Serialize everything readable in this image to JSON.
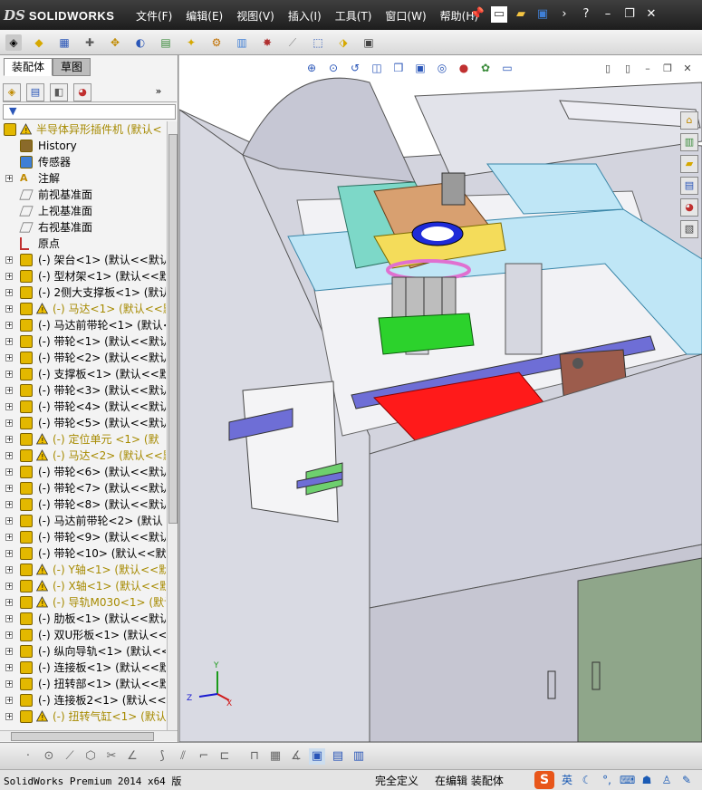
{
  "app": {
    "logo_ds": "DS",
    "logo_text": "SOLIDWORKS"
  },
  "menu": [
    "文件(F)",
    "编辑(E)",
    "视图(V)",
    "插入(I)",
    "工具(T)",
    "窗口(W)",
    "帮助(H)"
  ],
  "panel": {
    "tabs": [
      "装配体",
      "草图"
    ],
    "tree": [
      {
        "label": "半导体异形插件机  (默认<",
        "warn": true,
        "yellow": true,
        "icon": "assembly",
        "exp": "",
        "indent": 0
      },
      {
        "label": "History",
        "icon": "history",
        "exp": "",
        "indent": 1
      },
      {
        "label": "传感器",
        "icon": "sensor",
        "exp": "",
        "indent": 1
      },
      {
        "label": "注解",
        "icon": "annotation",
        "exp": "+",
        "indent": 1
      },
      {
        "label": "前视基准面",
        "icon": "plane",
        "exp": "",
        "indent": 1
      },
      {
        "label": "上视基准面",
        "icon": "plane",
        "exp": "",
        "indent": 1
      },
      {
        "label": "右视基准面",
        "icon": "plane",
        "exp": "",
        "indent": 1
      },
      {
        "label": "原点",
        "icon": "origin",
        "exp": "",
        "indent": 1
      },
      {
        "label": "(-) 架台<1> (默认<<默认",
        "icon": "part",
        "exp": "+",
        "indent": 1
      },
      {
        "label": "(-) 型材架<1> (默认<<默",
        "icon": "part",
        "exp": "+",
        "indent": 1
      },
      {
        "label": "(-) 2侧大支撑板<1> (默认",
        "icon": "part",
        "exp": "+",
        "indent": 1
      },
      {
        "label": "(-) 马达<1> (默认<<默",
        "warn": true,
        "yellow": true,
        "icon": "part",
        "exp": "+",
        "indent": 1
      },
      {
        "label": "(-) 马达前带轮<1> (默认<",
        "icon": "part",
        "exp": "+",
        "indent": 1
      },
      {
        "label": "(-) 带轮<1> (默认<<默认",
        "icon": "part",
        "exp": "+",
        "indent": 1
      },
      {
        "label": "(-) 带轮<2> (默认<<默认",
        "icon": "part",
        "exp": "+",
        "indent": 1
      },
      {
        "label": "(-) 支撑板<1> (默认<<默",
        "icon": "part",
        "exp": "+",
        "indent": 1
      },
      {
        "label": "(-) 带轮<3> (默认<<默认",
        "icon": "part",
        "exp": "+",
        "indent": 1
      },
      {
        "label": "(-) 带轮<4> (默认<<默认",
        "icon": "part",
        "exp": "+",
        "indent": 1
      },
      {
        "label": "(-) 带轮<5> (默认<<默认",
        "icon": "part",
        "exp": "+",
        "indent": 1
      },
      {
        "label": "(-) 定位单元 <1> (默",
        "warn": true,
        "yellow": true,
        "icon": "part",
        "exp": "+",
        "indent": 1
      },
      {
        "label": "(-) 马达<2> (默认<<默",
        "warn": true,
        "yellow": true,
        "icon": "part",
        "exp": "+",
        "indent": 1
      },
      {
        "label": "(-) 带轮<6> (默认<<默认",
        "icon": "part",
        "exp": "+",
        "indent": 1
      },
      {
        "label": "(-) 带轮<7> (默认<<默认",
        "icon": "part",
        "exp": "+",
        "indent": 1
      },
      {
        "label": "(-) 带轮<8> (默认<<默认",
        "icon": "part",
        "exp": "+",
        "indent": 1
      },
      {
        "label": "(-) 马达前带轮<2> (默认",
        "icon": "part",
        "exp": "+",
        "indent": 1
      },
      {
        "label": "(-) 带轮<9> (默认<<默认",
        "icon": "part",
        "exp": "+",
        "indent": 1
      },
      {
        "label": "(-) 带轮<10> (默认<<默",
        "icon": "part",
        "exp": "+",
        "indent": 1
      },
      {
        "label": "(-) Y轴<1> (默认<<默",
        "warn": true,
        "yellow": true,
        "icon": "part",
        "exp": "+",
        "indent": 1
      },
      {
        "label": "(-) X轴<1> (默认<<默",
        "warn": true,
        "yellow": true,
        "icon": "part",
        "exp": "+",
        "indent": 1
      },
      {
        "label": "(-) 导轨M030<1> (默认",
        "warn": true,
        "yellow": true,
        "icon": "part",
        "exp": "+",
        "indent": 1
      },
      {
        "label": "(-) 肋板<1> (默认<<默认",
        "icon": "part",
        "exp": "+",
        "indent": 1
      },
      {
        "label": "(-) 双U形板<1> (默认<<",
        "icon": "part",
        "exp": "+",
        "indent": 1
      },
      {
        "label": "(-) 纵向导轨<1> (默认<<",
        "icon": "part",
        "exp": "+",
        "indent": 1
      },
      {
        "label": "(-) 连接板<1> (默认<<默",
        "icon": "part",
        "exp": "+",
        "indent": 1
      },
      {
        "label": "(-) 扭转部<1> (默认<<默",
        "icon": "part",
        "exp": "+",
        "indent": 1
      },
      {
        "label": "(-) 连接板2<1> (默认<<",
        "icon": "part",
        "exp": "+",
        "indent": 1
      },
      {
        "label": "(-) 扭转气缸<1> (默认",
        "warn": true,
        "yellow": true,
        "icon": "part",
        "exp": "+",
        "indent": 1
      }
    ]
  },
  "triad": {
    "x": "X",
    "y": "Y",
    "z": "Z"
  },
  "status": {
    "left": "SolidWorks Premium 2014 x64 版",
    "definition": "完全定义",
    "mode": "在编辑 装配体",
    "ime_lang": "英",
    "ime_logo": "S"
  },
  "colors": {
    "accent": "#1b5bb5",
    "warning": "#f0c000",
    "model_shell": "#cfd0dc",
    "model_red": "#ff1a1a",
    "model_green": "#2cd22c"
  }
}
